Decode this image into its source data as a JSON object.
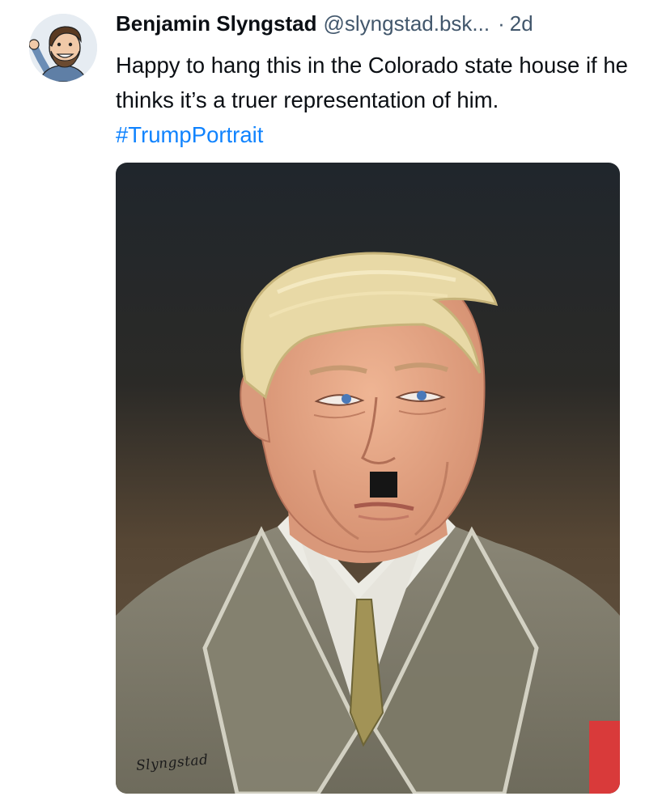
{
  "post": {
    "author": {
      "display_name": "Benjamin Slyngstad",
      "handle": "@slyngstad.bsk...",
      "avatar_icon": "cartoon-avatar-icon"
    },
    "separator": "·",
    "time_ago": "2d",
    "text_before_tag": "Happy to hang this in the Colorado state house if he thinks it’s a truer representation of him. ",
    "hashtag": "#TrumpPortrait",
    "image": {
      "signature": "Slyngstad"
    }
  },
  "colors": {
    "text": "#0b0f14",
    "secondary_text": "#42576c",
    "link": "#1083fe",
    "background": "#ffffff"
  }
}
